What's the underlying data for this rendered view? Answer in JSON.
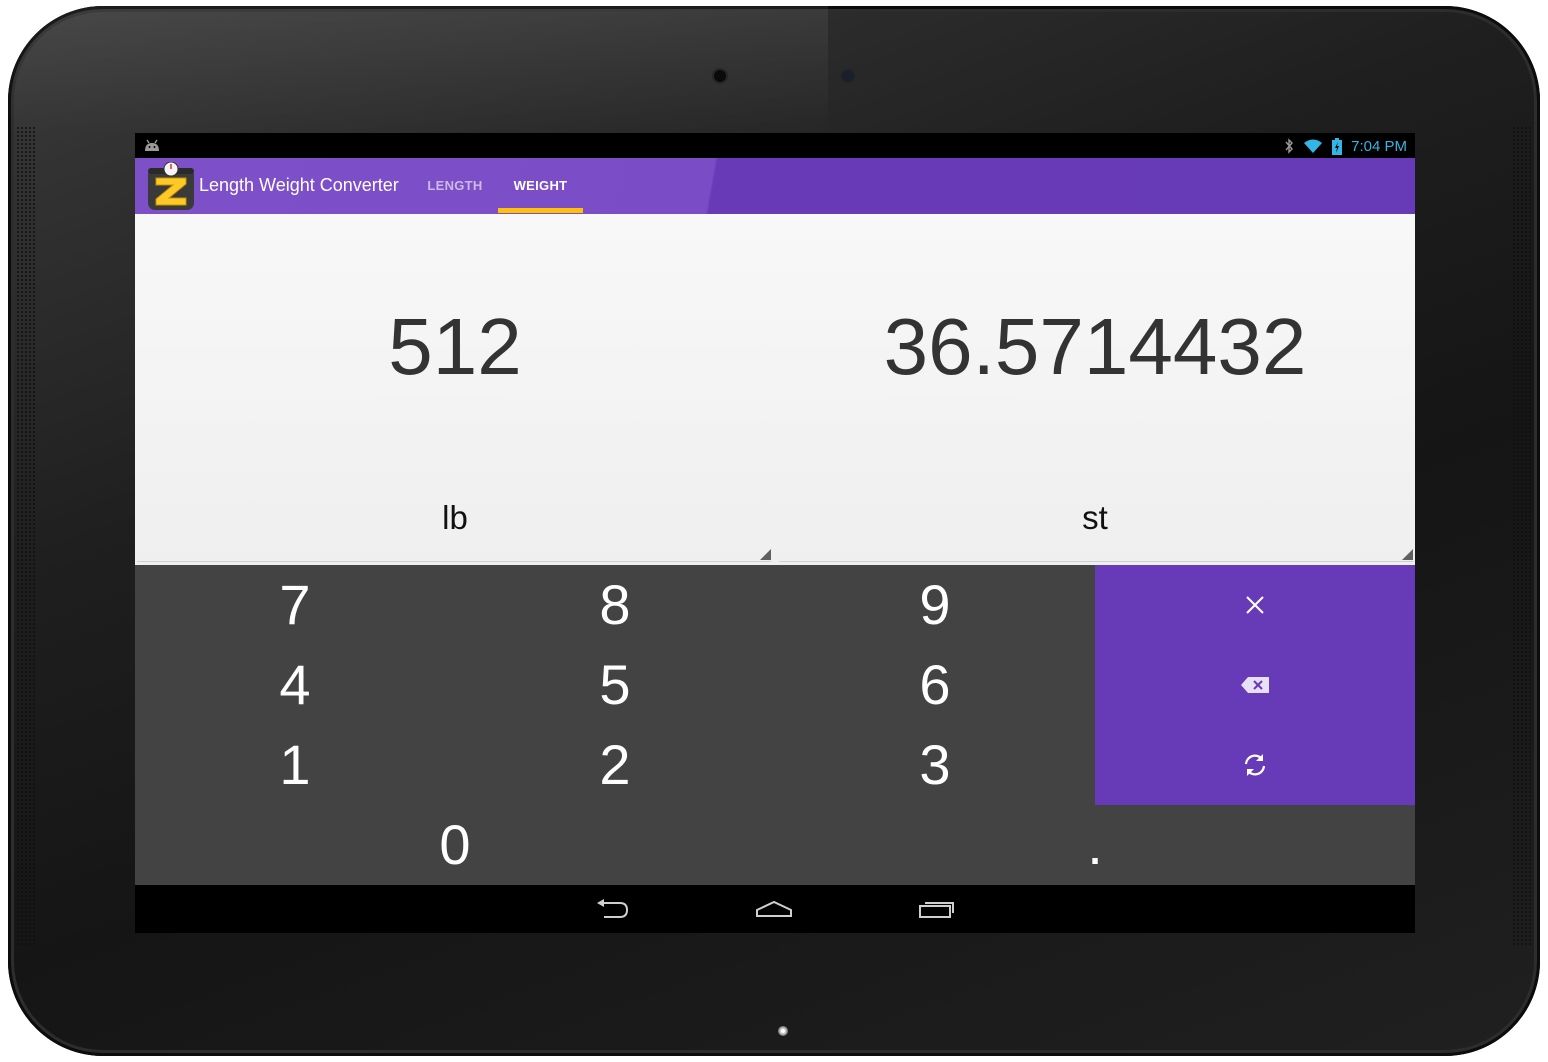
{
  "status_bar": {
    "time": "7:04 PM",
    "icons": [
      "android-notification-icon",
      "bluetooth-icon",
      "wifi-icon",
      "battery-icon"
    ],
    "time_color": "#33b5e5"
  },
  "app_bar": {
    "title": "Length Weight Converter",
    "tabs": [
      {
        "label": "LENGTH",
        "selected": false
      },
      {
        "label": "WEIGHT",
        "selected": true
      }
    ],
    "colors": {
      "primary": "#673ab7",
      "indicator": "#ffc107"
    }
  },
  "converter": {
    "input_value": "512",
    "output_value": "36.5714432",
    "input_unit": "lb",
    "output_unit": "st"
  },
  "keypad": {
    "keys": [
      "7",
      "8",
      "9",
      "4",
      "5",
      "6",
      "1",
      "2",
      "3",
      "0",
      "."
    ],
    "actions": [
      "clear-icon",
      "backspace-icon",
      "swap-refresh-icon"
    ],
    "background_color": "#434343"
  },
  "nav_bar": {
    "buttons": [
      "back-icon",
      "home-icon",
      "recent-apps-icon"
    ]
  }
}
